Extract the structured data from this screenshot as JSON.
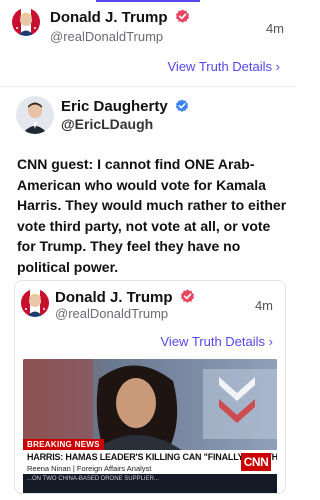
{
  "post": {
    "author_name": "Donald J. Trump",
    "author_handle": "@realDonaldTrump",
    "time": "4m",
    "details_link": "View Truth Details",
    "details_chevron": "›"
  },
  "shared": {
    "author_name": "Eric Daugherty",
    "author_handle": "@EricLDaugh",
    "text": "CNN guest: I cannot find ONE Arab-American who would vote for Kamala Harris. They would much rather to either vote third party, not vote at all, or vote for Trump. They feel they have no political power."
  },
  "quote": {
    "author_name": "Donald J. Trump",
    "author_handle": "@realDonaldTrump",
    "time": "4m",
    "details_link": "View Truth Details",
    "details_chevron": "›"
  },
  "video": {
    "breaking_label": "BREAKING NEWS",
    "headline": "HARRIS: HAMAS LEADER'S KILLING CAN \"FINALLY END THE WAR\"",
    "reporter": "Reena Ninan  |  Foreign Affairs Analyst",
    "network_logo": "CNN",
    "ticker": "...ON TWO CHINA-BASED DRONE SUPPLIER..."
  },
  "colors": {
    "accent": "#5448ee",
    "verified_badge": "#e94560",
    "eric_verified_badge": "#3b82f6",
    "cnn_red": "#cc0000"
  },
  "icons": {
    "verified": "verified-badge-icon",
    "chevron": "chevron-right-icon"
  }
}
